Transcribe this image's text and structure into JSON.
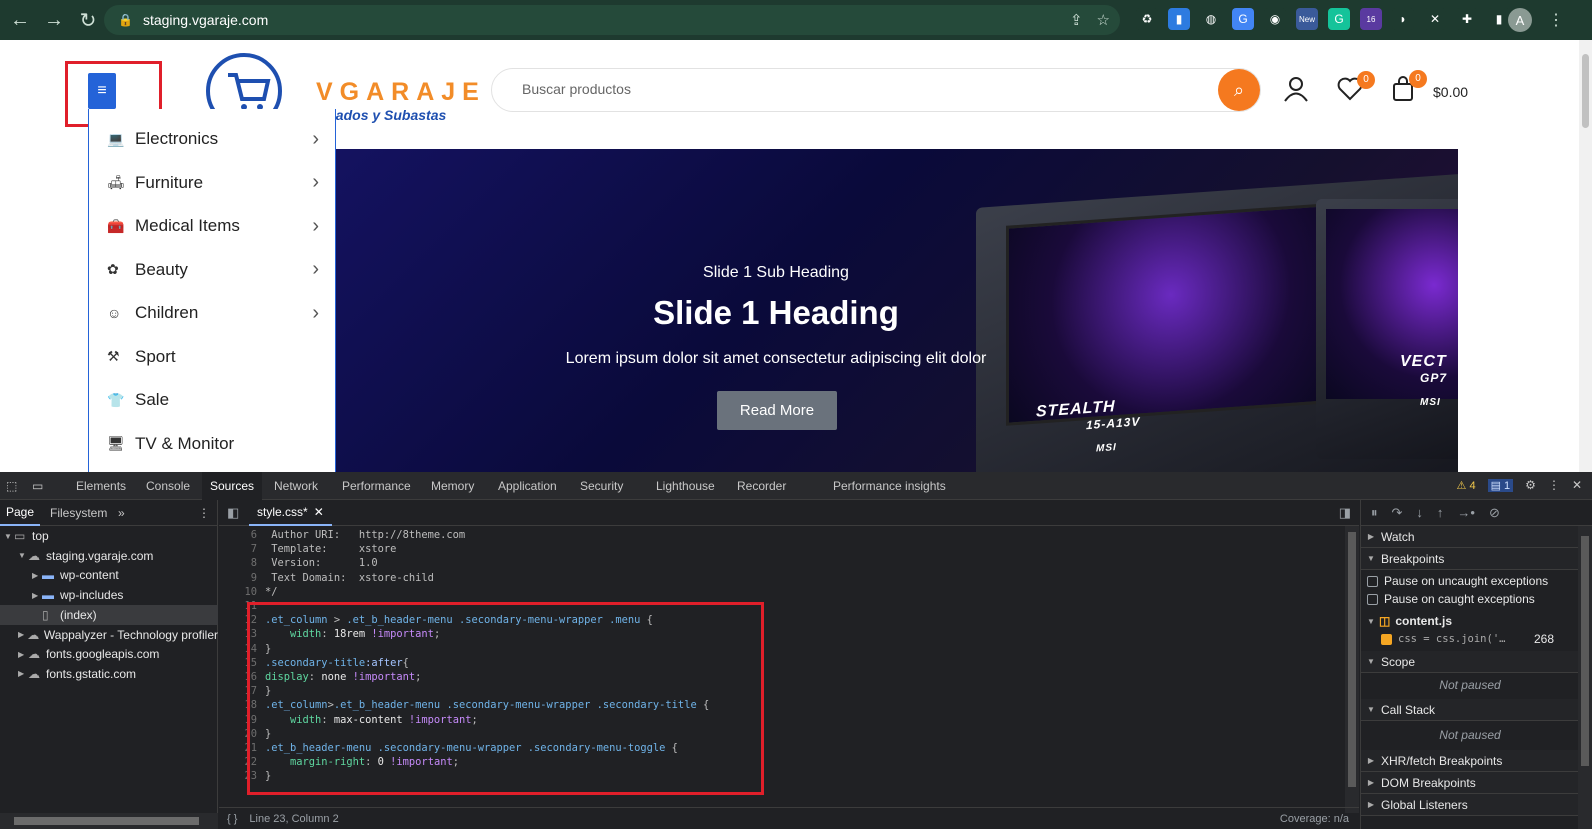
{
  "browser": {
    "url": "staging.vgaraje.com",
    "nav_icons": [
      "back-arrow-icon",
      "forward-arrow-icon",
      "reload-icon"
    ],
    "profile_initial": "A",
    "extensions": [
      {
        "name": "recycle-icon",
        "color": "#1e3a2f"
      },
      {
        "name": "docs-icon",
        "color": "#2d7be0"
      },
      {
        "name": "globe-icon",
        "color": "#1e3a2f"
      },
      {
        "name": "translate-icon",
        "color": "#4285f4"
      },
      {
        "name": "camera-icon",
        "color": "#1e3a2f"
      },
      {
        "name": "new-badge-icon",
        "color": "#3a5a9a",
        "label": "New"
      },
      {
        "name": "grammarly-icon",
        "color": "#15c39a"
      },
      {
        "name": "badge-16-icon",
        "color": "#5a3aa0",
        "label": "16"
      },
      {
        "name": "banana-icon",
        "color": "#1e3a2f"
      },
      {
        "name": "puzzle-x-icon",
        "color": "#1e3a2f"
      },
      {
        "name": "extensions-icon",
        "color": "#1e3a2f"
      },
      {
        "name": "sidebar-icon",
        "color": "#1e3a2f"
      }
    ]
  },
  "site": {
    "logo_name": "VGARAJE",
    "logo_tagline": "Clasificados y Subastas",
    "search_placeholder": "Buscar productos",
    "wishlist_count": "0",
    "cart_count": "0",
    "cart_total": "$0.00",
    "categories": [
      {
        "label": "Electronics",
        "icon": "laptop-icon",
        "has_submenu": true
      },
      {
        "label": "Furniture",
        "icon": "lamp-icon",
        "has_submenu": true
      },
      {
        "label": "Medical Items",
        "icon": "medical-kit-icon",
        "has_submenu": true
      },
      {
        "label": "Beauty",
        "icon": "beauty-icon",
        "has_submenu": true
      },
      {
        "label": "Children",
        "icon": "children-icon",
        "has_submenu": true
      },
      {
        "label": "Sport",
        "icon": "dumbbell-icon",
        "has_submenu": false
      },
      {
        "label": "Sale",
        "icon": "shirt-icon",
        "has_submenu": false
      },
      {
        "label": "TV & Monitor",
        "icon": "monitor-icon",
        "has_submenu": false
      }
    ],
    "slide": {
      "sub_heading": "Slide 1 Sub Heading",
      "heading": "Slide 1 Heading",
      "text": "Lorem ipsum dolor sit amet consectetur adipiscing elit dolor",
      "button": "Read More",
      "laptop1_label": "STEALTH",
      "laptop1_model": "15-A13V",
      "laptop1_brand": "MSI",
      "laptop2_label": "VECT",
      "laptop2_model": "GP7",
      "laptop2_brand": "MSI"
    }
  },
  "devtools": {
    "tabs": [
      "Elements",
      "Console",
      "Sources",
      "Network",
      "Performance",
      "Memory",
      "Application",
      "Security",
      "Lighthouse",
      "Recorder",
      "Performance insights"
    ],
    "active_tab": "Sources",
    "warnings": "4",
    "info": "1",
    "nav_tabs": [
      "Page",
      "Filesystem"
    ],
    "tree": [
      {
        "label": "top",
        "depth": 0,
        "icon": "frame-icon",
        "expanded": true
      },
      {
        "label": "staging.vgaraje.com",
        "depth": 1,
        "icon": "cloud-icon",
        "expanded": true
      },
      {
        "label": "wp-content",
        "depth": 2,
        "icon": "folder-icon",
        "expanded": false
      },
      {
        "label": "wp-includes",
        "depth": 2,
        "icon": "folder-icon",
        "expanded": false
      },
      {
        "label": "(index)",
        "depth": 2,
        "icon": "file-icon",
        "selected": true
      },
      {
        "label": "Wappalyzer - Technology profiler",
        "depth": 1,
        "icon": "cloud-icon",
        "expanded": false
      },
      {
        "label": "fonts.googleapis.com",
        "depth": 1,
        "icon": "cloud-icon",
        "expanded": false
      },
      {
        "label": "fonts.gstatic.com",
        "depth": 1,
        "icon": "cloud-icon",
        "expanded": false
      }
    ],
    "file_tab": "style.css*",
    "code_lines": [
      {
        "n": "6",
        "t": " Author URI:   http://8theme.com"
      },
      {
        "n": "7",
        "t": " Template:     xstore"
      },
      {
        "n": "8",
        "t": " Version:      1.0"
      },
      {
        "n": "9",
        "t": " Text Domain:  xstore-child"
      },
      {
        "n": "10",
        "t": "*/"
      },
      {
        "n": "11",
        "t": ""
      },
      {
        "n": "12",
        "t": ".et_column > .et_b_header-menu .secondary-menu-wrapper .menu {"
      },
      {
        "n": "13",
        "t": "    width: 18rem !important;"
      },
      {
        "n": "14",
        "t": "}"
      },
      {
        "n": "15",
        "t": ".secondary-title:after{"
      },
      {
        "n": "16",
        "t": "display: none !important;"
      },
      {
        "n": "17",
        "t": "}"
      },
      {
        "n": "18",
        "t": ".et_column>.et_b_header-menu .secondary-menu-wrapper .secondary-title {"
      },
      {
        "n": "19",
        "t": "    width: max-content !important;"
      },
      {
        "n": "20",
        "t": "}"
      },
      {
        "n": "21",
        "t": ".et_b_header-menu .secondary-menu-wrapper .secondary-menu-toggle {"
      },
      {
        "n": "22",
        "t": "    margin-right: 0 !important;"
      },
      {
        "n": "23",
        "t": "}"
      }
    ],
    "status_position": "Line 23, Column 2",
    "coverage": "Coverage: n/a",
    "debugger": {
      "watch": "Watch",
      "breakpoints": "Breakpoints",
      "pause_uncaught": "Pause on uncaught exceptions",
      "pause_caught": "Pause on caught exceptions",
      "bp_file": "content.js",
      "bp_code": "css = css.join('…",
      "bp_line": "268",
      "scope": "Scope",
      "not_paused": "Not paused",
      "call_stack": "Call Stack",
      "not_paused2": "Not paused",
      "xhr": "XHR/fetch Breakpoints",
      "dom": "DOM Breakpoints",
      "global": "Global Listeners"
    }
  }
}
